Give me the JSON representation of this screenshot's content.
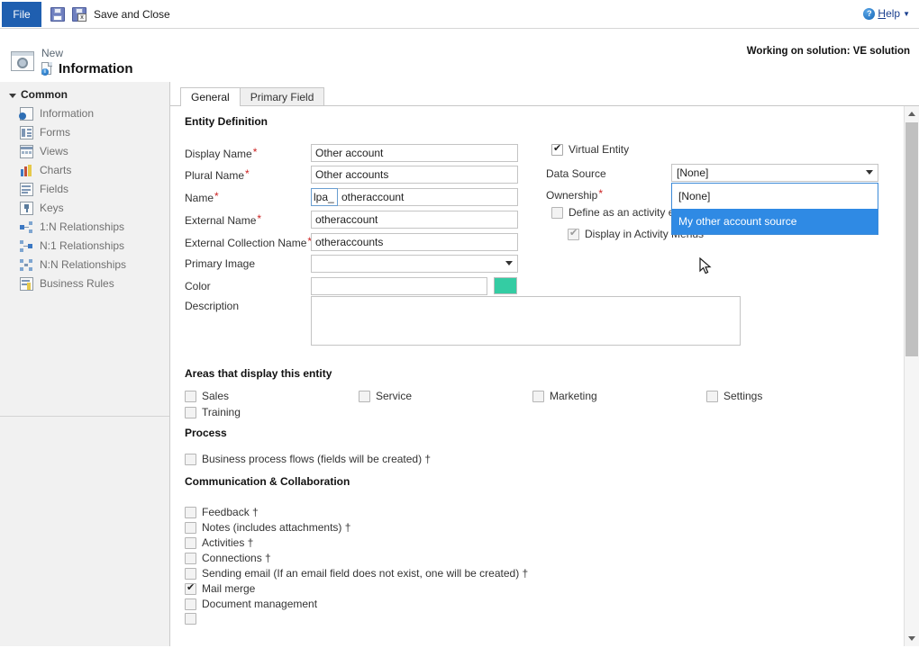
{
  "ribbon": {
    "file_label": "File",
    "save_icon": "save-icon",
    "save_close_icon": "save-and-close-icon",
    "save_close_label": "Save and Close",
    "help_label": "Help",
    "help_accel": "H",
    "help_icon": "help-circle-icon",
    "help_caret": "▼"
  },
  "header": {
    "record_state": "New",
    "title": "Information",
    "entity_icon": "entity-window-gear-icon",
    "info_icon": "information-page-icon",
    "solution_note": "Working on solution: VE solution"
  },
  "sidebar": {
    "group_label": "Common",
    "items": [
      {
        "label": "Information",
        "icon": "information-icon"
      },
      {
        "label": "Forms",
        "icon": "forms-icon"
      },
      {
        "label": "Views",
        "icon": "views-icon"
      },
      {
        "label": "Charts",
        "icon": "charts-icon"
      },
      {
        "label": "Fields",
        "icon": "fields-icon"
      },
      {
        "label": "Keys",
        "icon": "keys-icon"
      },
      {
        "label": "1:N Relationships",
        "icon": "one-to-many-icon"
      },
      {
        "label": "N:1 Relationships",
        "icon": "many-to-one-icon"
      },
      {
        "label": "N:N Relationships",
        "icon": "many-to-many-icon"
      },
      {
        "label": "Business Rules",
        "icon": "business-rules-icon"
      }
    ]
  },
  "tabs": [
    {
      "label": "General",
      "active": true
    },
    {
      "label": "Primary Field",
      "active": false
    }
  ],
  "form": {
    "section_entity_definition": "Entity Definition",
    "fields": {
      "display_name": {
        "label": "Display Name",
        "required": true,
        "value": "Other account"
      },
      "plural_name": {
        "label": "Plural Name",
        "required": true,
        "value": "Other accounts"
      },
      "name": {
        "label": "Name",
        "required": true,
        "prefix": "lpa_",
        "value": "otheraccount"
      },
      "external_name": {
        "label": "External Name",
        "required": true,
        "value": "otheraccount"
      },
      "external_collection_name": {
        "label": "External Collection Name",
        "required": true,
        "value": "otheraccounts"
      },
      "primary_image": {
        "label": "Primary Image",
        "required": false,
        "value": ""
      },
      "color": {
        "label": "Color",
        "required": false,
        "value": "",
        "swatch_hex": "#34CCA3"
      },
      "description": {
        "label": "Description",
        "required": false,
        "value": ""
      }
    },
    "right": {
      "virtual_entity": {
        "label": "Virtual Entity",
        "checked": true
      },
      "data_source": {
        "label": "Data Source",
        "value": "[None]",
        "open": true,
        "options": [
          {
            "label": "[None]",
            "selected": false
          },
          {
            "label": "My other account source",
            "selected": true
          }
        ]
      },
      "ownership": {
        "label": "Ownership",
        "required": true
      },
      "define_activity_entity": {
        "label": "Define as an activity entity",
        "checked": false
      },
      "display_activity_menus": {
        "label": "Display in Activity Menus",
        "checked": true,
        "disabled": true
      }
    }
  },
  "areas": {
    "title": "Areas that display this entity",
    "items": [
      {
        "label": "Sales",
        "checked": false
      },
      {
        "label": "Service",
        "checked": false
      },
      {
        "label": "Marketing",
        "checked": false
      },
      {
        "label": "Settings",
        "checked": false
      },
      {
        "label": "Training",
        "checked": false
      }
    ]
  },
  "process": {
    "title": "Process",
    "items": [
      {
        "label": "Business process flows (fields will be created) †",
        "checked": false
      }
    ]
  },
  "communication": {
    "title": "Communication & Collaboration",
    "items": [
      {
        "label": "Feedback †",
        "checked": false
      },
      {
        "label": "Notes (includes attachments) †",
        "checked": false
      },
      {
        "label": "Activities †",
        "checked": false
      },
      {
        "label": "Connections †",
        "checked": false
      },
      {
        "label": "Sending email (If an email field does not exist, one will be created) †",
        "checked": false
      },
      {
        "label": "Mail merge",
        "checked": true
      },
      {
        "label": "Document management",
        "checked": false
      }
    ]
  },
  "scrollbar": {
    "up_arrow": "scroll-up-arrow",
    "down_arrow": "scroll-down-arrow"
  },
  "colors": {
    "file_tab_blue": "#1f5fb0",
    "highlight_blue": "#2f8ae4",
    "required_red": "#cc2222",
    "entity_color_swatch": "#34CCA3"
  }
}
